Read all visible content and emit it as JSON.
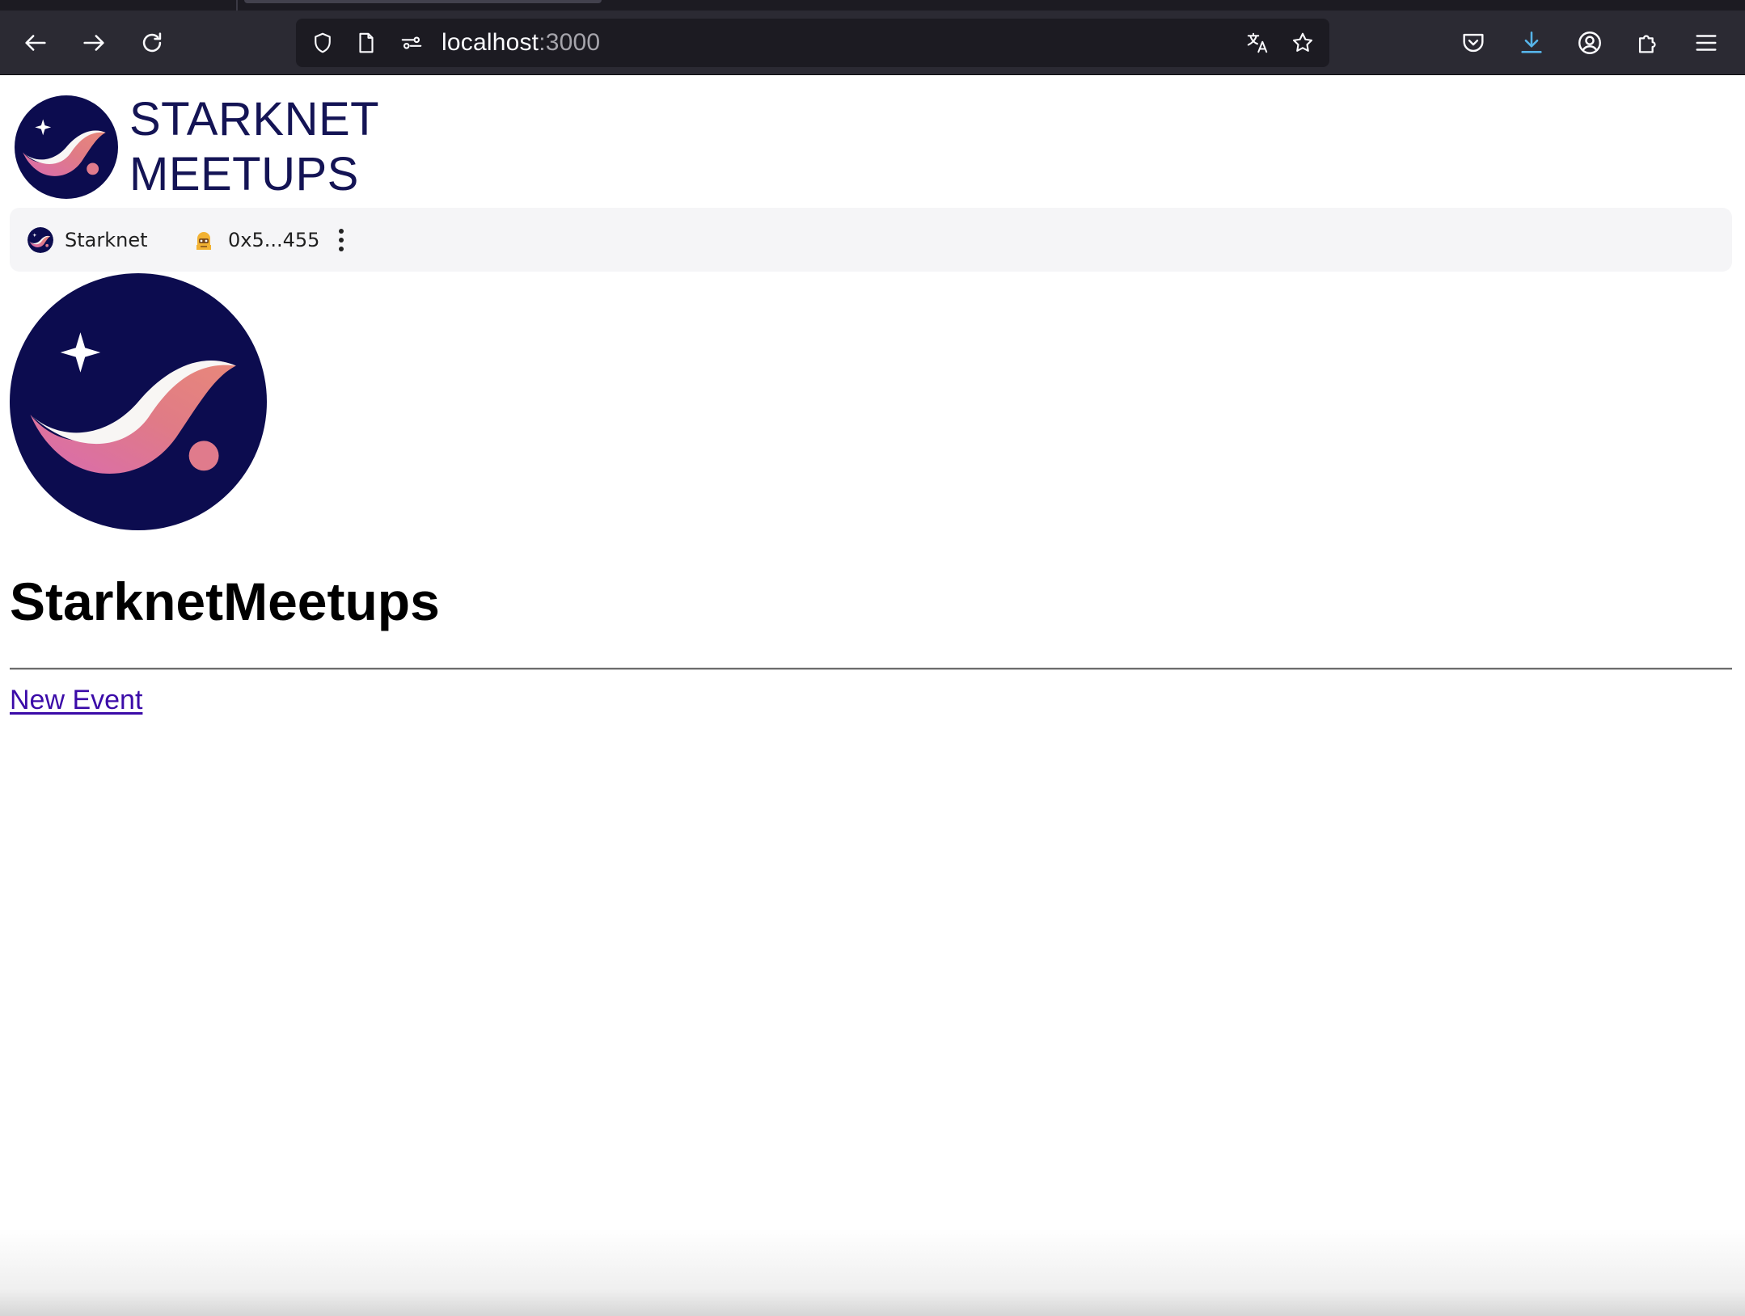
{
  "browser": {
    "url_host": "localhost",
    "url_port": ":3000",
    "icons": {
      "back": "arrow-left-icon",
      "forward": "arrow-right-icon",
      "reload": "reload-icon",
      "tracking": "shield-icon",
      "page": "page-icon",
      "permissions": "permissions-icon",
      "translate": "translate-icon",
      "bookmark": "star-icon",
      "pocket": "pocket-icon",
      "downloads": "download-icon",
      "account": "account-icon",
      "extensions": "puzzle-icon",
      "menu": "hamburger-menu-icon"
    }
  },
  "header": {
    "brand_line1": "STARKNET",
    "brand_line2": "MEETUPS"
  },
  "wallet_bar": {
    "network_label": "Starknet",
    "account_label": "0x5...455",
    "more_icon": "more-vertical-icon"
  },
  "main": {
    "title": "StarknetMeetups",
    "new_event_link": "New Event"
  },
  "colors": {
    "brand_navy": "#0c0c4f",
    "brand_text": "#141455",
    "wave_pink": "#e07b7b",
    "wave_light": "#f8f6f4",
    "link": "#3b0ba8",
    "download_accent": "#56b4e9"
  }
}
